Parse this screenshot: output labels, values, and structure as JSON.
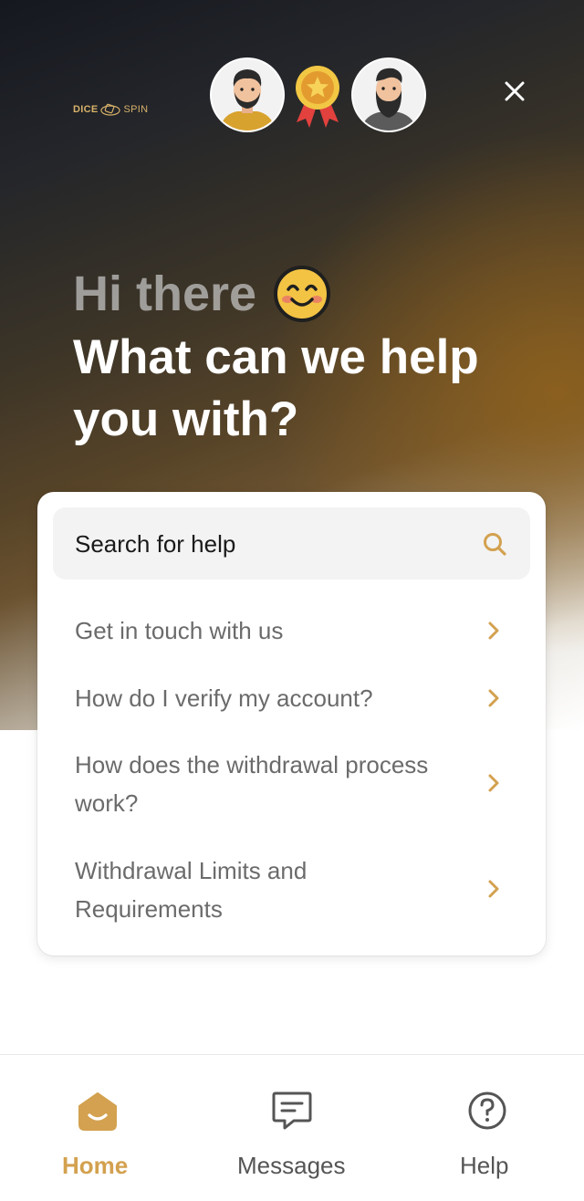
{
  "brand": {
    "logo_left": "DICE",
    "logo_right": "SPIN"
  },
  "header": {
    "close_icon": "close-icon",
    "greeting": "Hi there",
    "greeting_emoji": "smiling-face-emoji",
    "headline": "What can we help you with?"
  },
  "avatars": [
    "agent-avatar-1",
    "award-badge",
    "agent-avatar-2"
  ],
  "search": {
    "label": "Search for help",
    "icon": "search-icon"
  },
  "help_items": [
    {
      "label": "Get in touch with us"
    },
    {
      "label": "How do I verify my account?"
    },
    {
      "label": "How does the withdrawal process work?"
    },
    {
      "label": "Withdrawal Limits and Requirements"
    }
  ],
  "nav": [
    {
      "label": "Home",
      "icon": "home-icon",
      "active": true
    },
    {
      "label": "Messages",
      "icon": "messages-icon",
      "active": false
    },
    {
      "label": "Help",
      "icon": "help-icon",
      "active": false
    }
  ],
  "colors": {
    "accent": "#d3a14f",
    "nav_inactive": "#555555",
    "item_text": "#6b6b6b",
    "chevron": "#d3a14f"
  }
}
